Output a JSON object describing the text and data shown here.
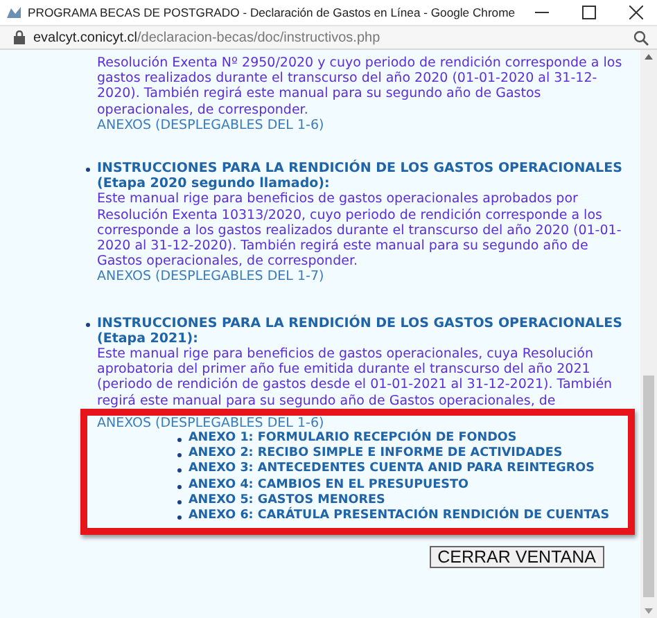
{
  "window": {
    "title": "PROGRAMA BECAS DE POSTGRADO - Declaración de Gastos en Línea - Google Chrome"
  },
  "address_bar": {
    "url_host": "evalcyt.conicyt.cl",
    "url_path": "/declaracion-becas/doc/instructivos.php"
  },
  "sections": [
    {
      "description": "Resolución Exenta Nº 2950/2020 y cuyo periodo de rendición corresponde a los gastos realizados durante el transcurso del año 2020 (01-01-2020 al 31-12-2020). También regirá este manual para su segundo año de Gastos operacionales, de corresponder.",
      "annex_link": "ANEXOS (DESPLEGABLES DEL 1-6)",
      "highlighted": false
    },
    {
      "heading": "INSTRUCCIONES PARA LA RENDICIÓN DE LOS GASTOS OPERACIONALES (Etapa 2020 segundo llamado):",
      "description": "Este manual rige para beneficios de gastos operacionales aprobados por Resolución Exenta 10313/2020, cuyo periodo de rendición corresponde a los corresponde a los gastos realizados durante el transcurso del año 2020 (01-01-2020 al 31-12-2020). También regirá este manual para su segundo año de Gastos operacionales, de corresponder.",
      "annex_link": "ANEXOS (DESPLEGABLES DEL 1-7)",
      "highlighted": false
    },
    {
      "heading": "INSTRUCCIONES PARA LA RENDICIÓN DE LOS GASTOS OPERACIONALES (Etapa 2021):",
      "description": "Este manual rige para beneficios de gastos operacionales, cuya Resolución aprobatoria del primer año fue emitida durante el transcurso del año 2021 (periodo de rendición de gastos desde el 01-01-2021 al 31-12-2021). También regirá este manual para su segundo año de Gastos operacionales, de",
      "annex_link": "ANEXOS (DESPLEGABLES DEL 1-6)",
      "highlighted": true,
      "annexes": [
        "ANEXO 1: FORMULARIO RECEPCIÓN DE FONDOS",
        "ANEXO 2: RECIBO SIMPLE E INFORME DE ACTIVIDADES",
        "ANEXO 3: ANTECEDENTES CUENTA ANID PARA REINTEGROS",
        "ANEXO 4: CAMBIOS EN EL PRESUPUESTO",
        "ANEXO 5: GASTOS MENORES",
        "ANEXO 6: CARÁTULA PRESENTACIÓN RENDICIÓN DE CUENTAS"
      ]
    }
  ],
  "close_button": "CERRAR VENTANA"
}
